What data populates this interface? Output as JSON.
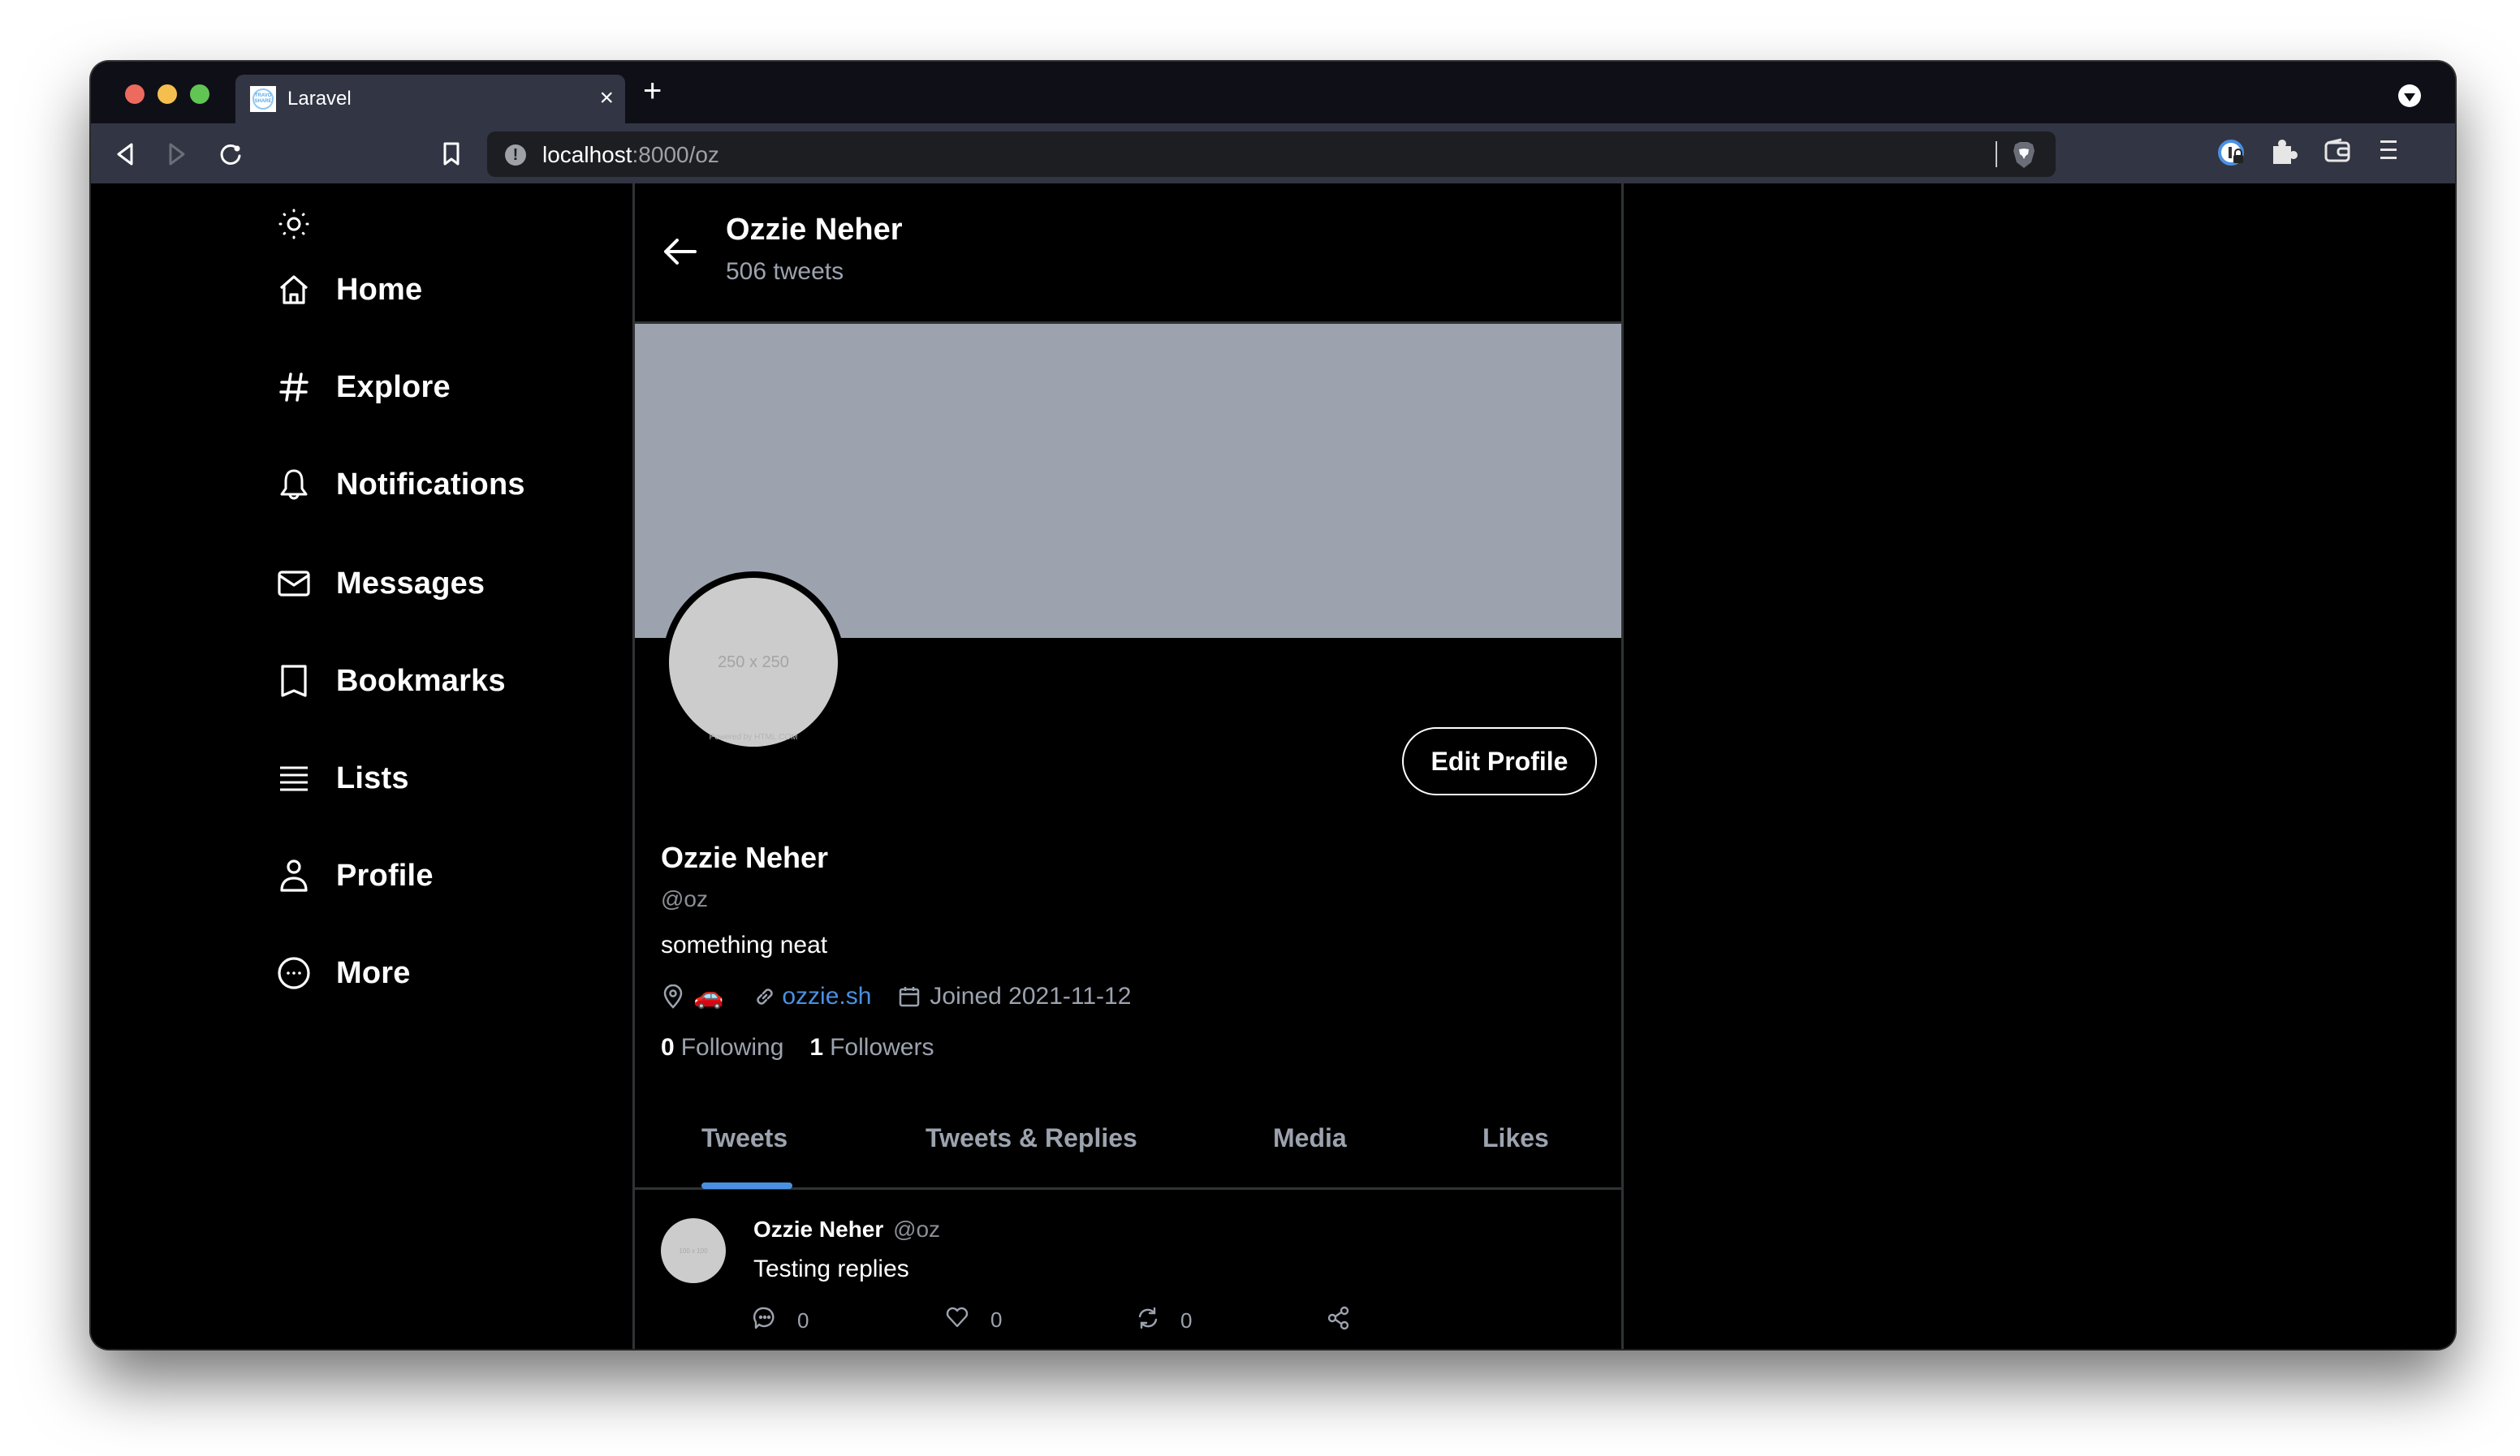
{
  "browser": {
    "tab_title": "Laravel",
    "favicon_text": "TRAVO SHARE",
    "tab_close": "×",
    "new_tab": "+",
    "url_host": "localhost",
    "url_rest": ":8000/oz"
  },
  "sidebar": {
    "items": [
      {
        "label": "Home",
        "icon": "home-icon"
      },
      {
        "label": "Explore",
        "icon": "hashtag-icon"
      },
      {
        "label": "Notifications",
        "icon": "bell-icon"
      },
      {
        "label": "Messages",
        "icon": "envelope-icon"
      },
      {
        "label": "Bookmarks",
        "icon": "bookmark-icon"
      },
      {
        "label": "Lists",
        "icon": "list-icon"
      },
      {
        "label": "Profile",
        "icon": "user-icon"
      },
      {
        "label": "More",
        "icon": "more-circle-icon"
      }
    ]
  },
  "header": {
    "name": "Ozzie Neher",
    "tweet_count": "506 tweets"
  },
  "profile": {
    "avatar_placeholder": "250 x 250",
    "avatar_powered": "Powered by HTML.COM",
    "edit_label": "Edit Profile",
    "name": "Ozzie Neher",
    "handle": "@oz",
    "bio": "something neat",
    "location": "🚗",
    "website": "ozzie.sh",
    "joined": "Joined 2021-11-12",
    "following_count": "0",
    "following_label": "Following",
    "followers_count": "1",
    "followers_label": "Followers"
  },
  "tabs": [
    {
      "label": "Tweets",
      "active": true
    },
    {
      "label": "Tweets & Replies",
      "active": false
    },
    {
      "label": "Media",
      "active": false
    },
    {
      "label": "Likes",
      "active": false
    }
  ],
  "tweets": [
    {
      "avatar_placeholder": "100 x 100",
      "author": "Ozzie Neher",
      "handle": "@oz",
      "body": "Testing replies",
      "replies": "0",
      "likes": "0",
      "retweets": "0"
    }
  ],
  "colors": {
    "accent": "#4a90e2",
    "banner": "#9ca3af",
    "muted_text": "#9ca3af"
  }
}
